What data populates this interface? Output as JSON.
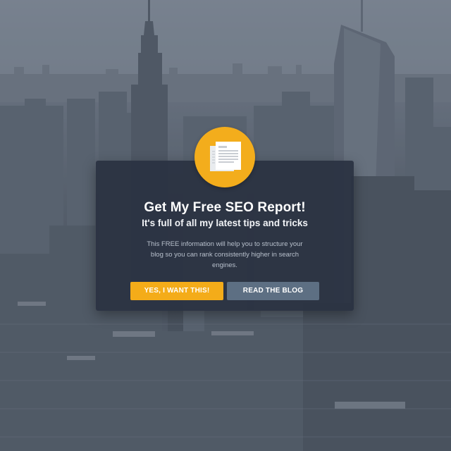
{
  "popup": {
    "badge_icon": "document-stack-icon",
    "title": "Get My Free SEO Report!",
    "subtitle": "It's full of all my latest tips and tricks",
    "body": "This FREE information will help you to structure your blog so you can rank consistently higher in search engines.",
    "primary_button": "YES, I WANT THIS!",
    "secondary_button": "READ THE BLOG"
  },
  "colors": {
    "accent": "#f4ac19",
    "secondary_button": "#5d6f83",
    "modal_bg": "#2b3242",
    "background": "#6c7480"
  }
}
